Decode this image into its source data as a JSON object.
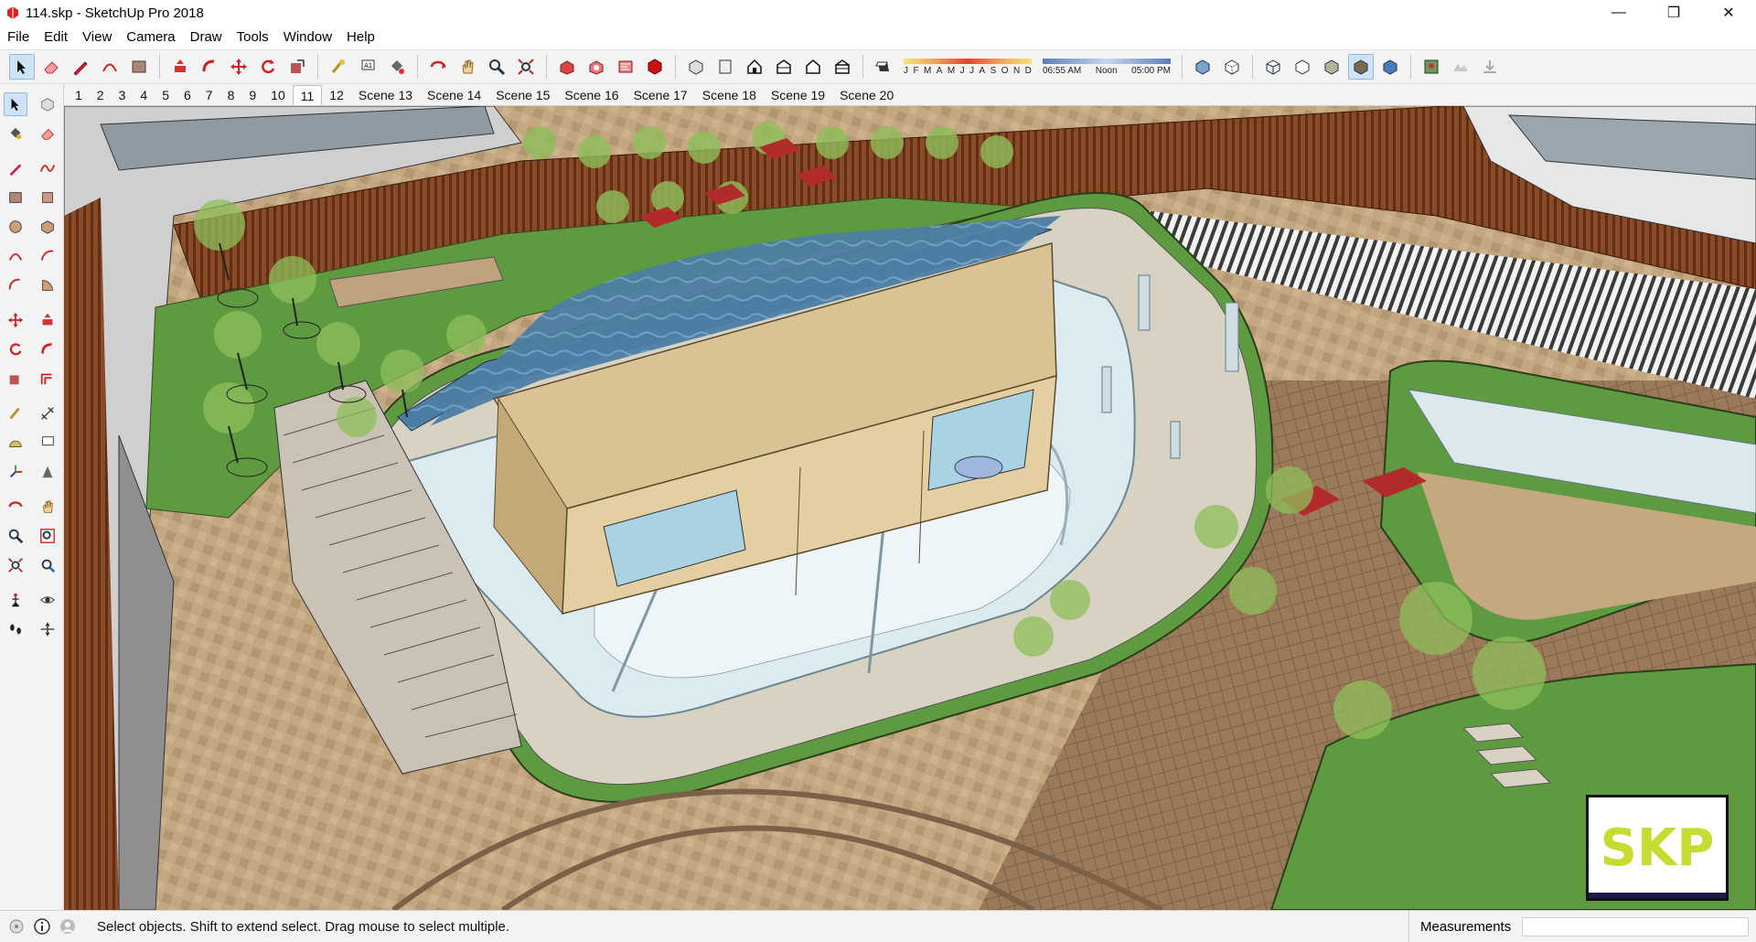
{
  "window": {
    "title": "114.skp - SketchUp Pro 2018",
    "app_icon": "sketchup-logo-icon",
    "controls": [
      "minimize-icon",
      "restore-icon",
      "close-icon"
    ]
  },
  "menu": [
    "File",
    "Edit",
    "View",
    "Camera",
    "Draw",
    "Tools",
    "Window",
    "Help"
  ],
  "toolbar": {
    "shadow_months": [
      "J",
      "F",
      "M",
      "A",
      "M",
      "J",
      "J",
      "A",
      "S",
      "O",
      "N",
      "D"
    ],
    "time_start": "06:55 AM",
    "time_mid": "Noon",
    "time_end": "05:00 PM"
  },
  "scenes": {
    "tabs": [
      "1",
      "2",
      "3",
      "4",
      "5",
      "6",
      "7",
      "8",
      "9",
      "10",
      "11",
      "12",
      "Scene 13",
      "Scene 14",
      "Scene 15",
      "Scene 16",
      "Scene 17",
      "Scene 18",
      "Scene 19",
      "Scene 20"
    ],
    "active": "11"
  },
  "viewport": {
    "badge": "SKP",
    "badge_color": "#c6dc33"
  },
  "status": {
    "message": "Select objects. Shift to extend select. Drag mouse to select multiple.",
    "measurements_label": "Measurements",
    "measurements_value": ""
  },
  "colors": {
    "grass": "#5e9a3f",
    "paving": "#bfa37e",
    "wood": "#8d4a24",
    "water": "#4f7ea3",
    "glass": "#d9e9ef",
    "selection": "#cfe3f6"
  }
}
